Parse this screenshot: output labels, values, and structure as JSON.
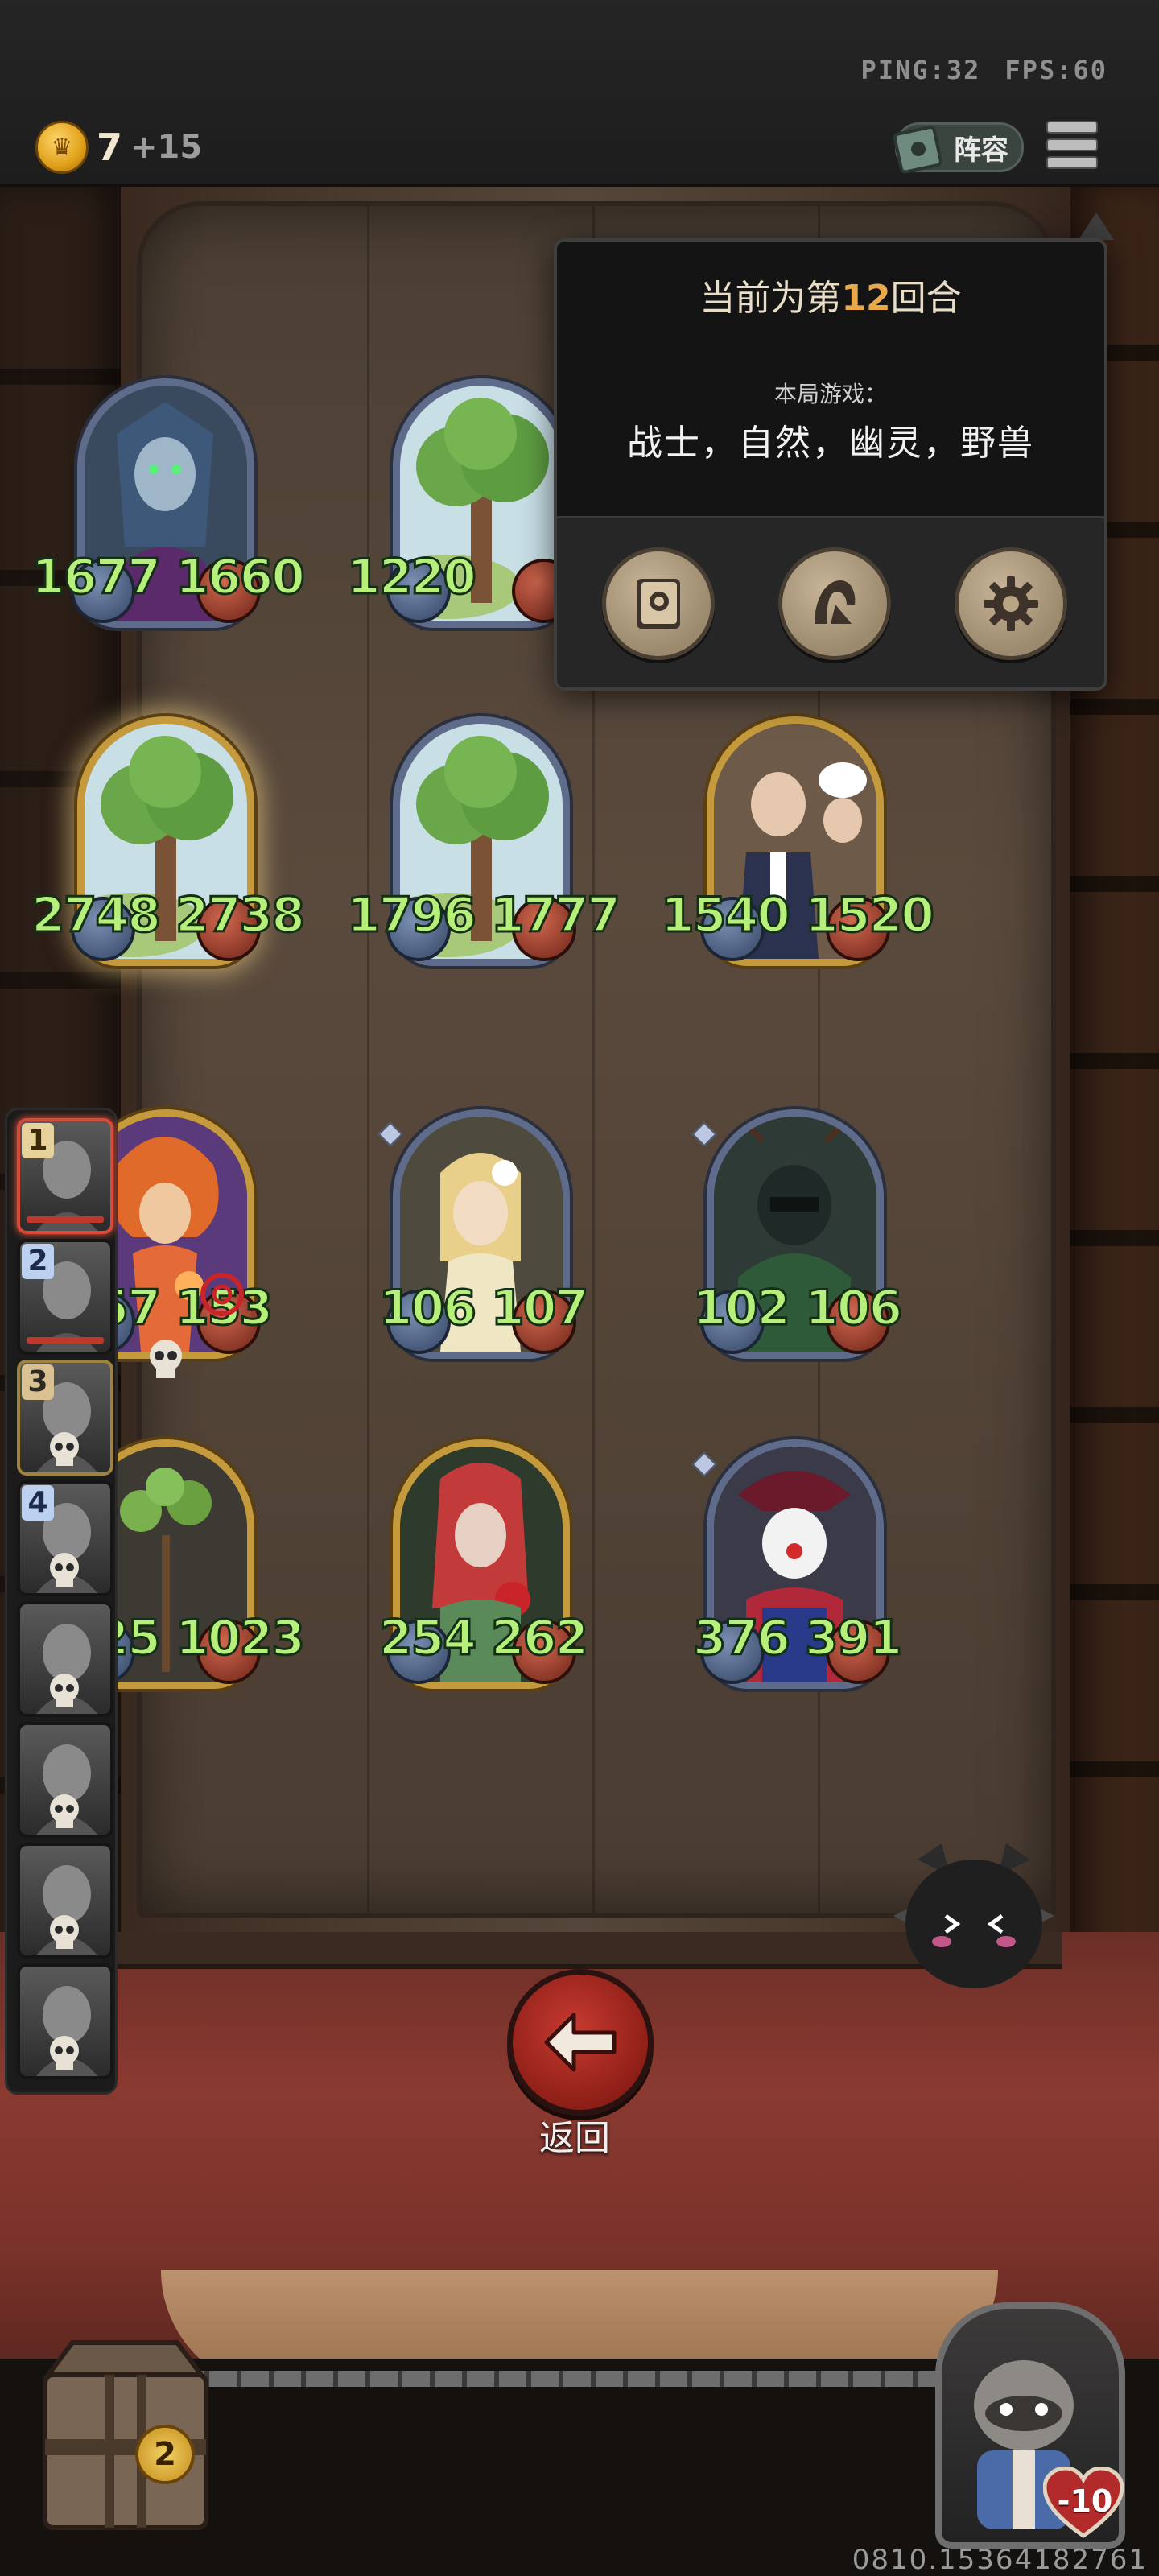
{
  "network": {
    "ping": "PING:32",
    "fps": "FPS:60"
  },
  "gold": {
    "value": "7",
    "bonus": "+15",
    "icon": "crown-coin-icon"
  },
  "lineup_button": {
    "label": "阵容",
    "icon": "book-icon"
  },
  "menu_icon": "hamburger-menu-icon",
  "popup": {
    "round_prefix": "当前为第",
    "round_number": "12",
    "round_suffix": "回合",
    "mode_label": "本局游戏：",
    "factions": "战士，自然，幽灵，野兽",
    "buttons": [
      {
        "name": "card-codex-button",
        "icon": "rose-book-icon"
      },
      {
        "name": "hero-info-button",
        "icon": "hood-icon"
      },
      {
        "name": "settings-button",
        "icon": "gear-icon"
      }
    ]
  },
  "board": {
    "cards": [
      {
        "attack": "1677",
        "health": "1660",
        "frame": "silver",
        "art": "elf-sorceress"
      },
      {
        "attack": "1220",
        "health": "",
        "frame": "silver",
        "art": "tree"
      },
      {
        "attack": "2748",
        "health": "2738",
        "frame": "gold",
        "art": "tree",
        "highlight": true
      },
      {
        "attack": "1796",
        "health": "1777",
        "frame": "silver",
        "art": "tree"
      },
      {
        "attack": "1540",
        "health": "1520",
        "frame": "gold",
        "art": "butler-and-chef"
      },
      {
        "attack": "157",
        "health": "153",
        "frame": "gold",
        "art": "fire-fairy",
        "stars": 4,
        "marks": [
          "skull-icon",
          "spiral-icon"
        ]
      },
      {
        "attack": "106",
        "health": "107",
        "frame": "silver",
        "art": "flower-elf",
        "stars": 1
      },
      {
        "attack": "102",
        "health": "106",
        "frame": "silver",
        "art": "forest-spirit",
        "stars": 1
      },
      {
        "attack": "1025",
        "health": "1023",
        "frame": "gold",
        "art": "sapling",
        "stars": 4,
        "marks": [
          "purple-flame-icon"
        ]
      },
      {
        "attack": "254",
        "health": "262",
        "frame": "gold",
        "art": "rose-elf"
      },
      {
        "attack": "376",
        "health": "391",
        "frame": "silver",
        "art": "clown",
        "stars": 1
      }
    ]
  },
  "roster": [
    {
      "rank": "1",
      "state": "self"
    },
    {
      "rank": "2",
      "state": "alive"
    },
    {
      "rank": "3",
      "state": "eliminated"
    },
    {
      "rank": "4",
      "state": "eliminated"
    },
    {
      "rank": "",
      "state": "eliminated"
    },
    {
      "rank": "",
      "state": "eliminated"
    },
    {
      "rank": "",
      "state": "eliminated"
    },
    {
      "rank": "",
      "state": "eliminated"
    }
  ],
  "back_button": {
    "label": "返回",
    "icon": "arrow-left-icon"
  },
  "crate": {
    "count": "2",
    "icon": "treasure-crate-icon"
  },
  "hero": {
    "health": "-10",
    "icon": "raccoon-hero-icon"
  },
  "pet_icon": "shadow-cat-pet-icon",
  "user_id": "0810.15364182761",
  "colors": {
    "stat_green": "#b6f07a",
    "round_accent": "#e9a94a",
    "back_red": "#c73a30"
  }
}
